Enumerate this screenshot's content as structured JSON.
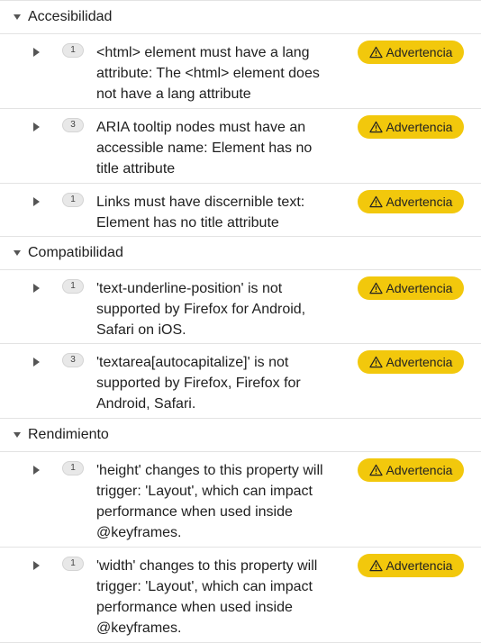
{
  "categories": [
    {
      "name": "Accesibilidad",
      "issues": [
        {
          "count": "1",
          "text": "<html> element must have a lang\nattribute: The <html> element does\nnot have a lang attribute",
          "severity": "Advertencia"
        },
        {
          "count": "3",
          "text": "ARIA tooltip nodes must have an\naccessible name: Element has no\ntitle attribute",
          "severity": "Advertencia"
        },
        {
          "count": "1",
          "text": "Links must have discernible text:\nElement has no title attribute",
          "severity": "Advertencia"
        }
      ]
    },
    {
      "name": "Compatibilidad",
      "issues": [
        {
          "count": "1",
          "text": "'text-underline-position' is not\nsupported by Firefox for Android,\nSafari on iOS.",
          "severity": "Advertencia"
        },
        {
          "count": "3",
          "text": "'textarea[autocapitalize]' is not\nsupported by Firefox, Firefox for\nAndroid, Safari.",
          "severity": "Advertencia"
        }
      ]
    },
    {
      "name": "Rendimiento",
      "issues": [
        {
          "count": "1",
          "text": "'height' changes to this property will\ntrigger: 'Layout', which can impact\nperformance when used inside\n@keyframes.",
          "severity": "Advertencia"
        },
        {
          "count": "1",
          "text": "'width' changes to this property will\ntrigger: 'Layout', which can impact\nperformance when used inside\n@keyframes.",
          "severity": "Advertencia"
        }
      ]
    }
  ],
  "icons": {
    "category_toggle": "caret-down-icon",
    "issue_toggle": "caret-right-icon",
    "severity": "warning-triangle-icon"
  },
  "colors": {
    "severity_badge": "#f2c80c",
    "divider": "#e3e3e3",
    "count_badge": "#e8e8e8"
  }
}
